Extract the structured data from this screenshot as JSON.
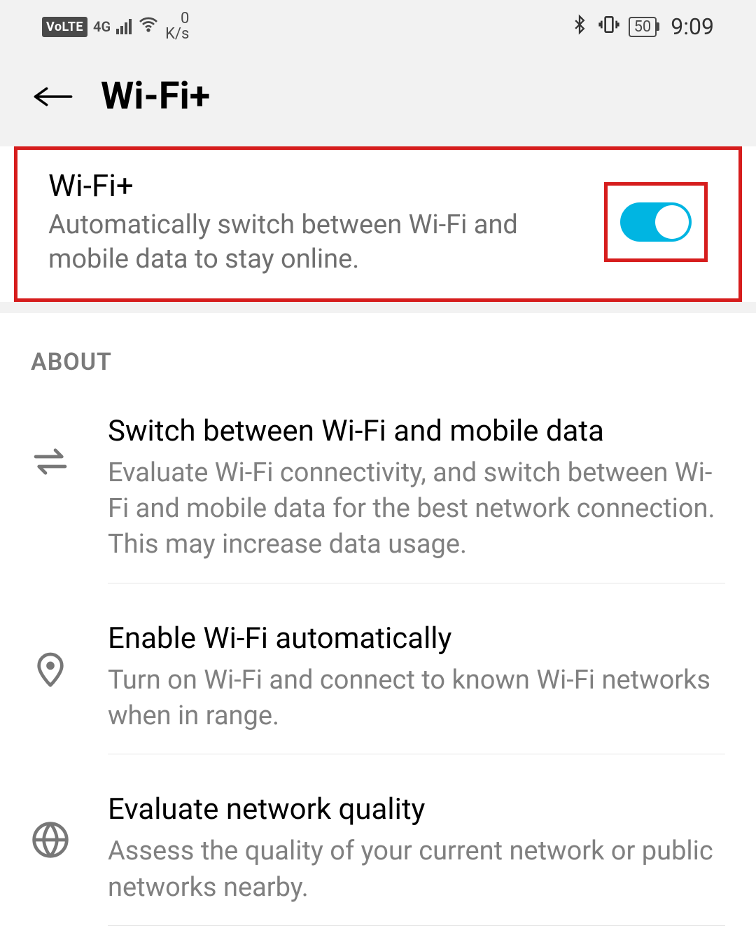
{
  "status_bar": {
    "volte": "VoLTE",
    "network": "4G",
    "data_rate_value": "0",
    "data_rate_unit": "K/s",
    "battery": "50",
    "time": "9:09"
  },
  "header": {
    "title": "Wi-Fi+"
  },
  "toggle": {
    "title": "Wi-Fi+",
    "description": "Automatically switch between Wi-Fi and mobile data to stay online.",
    "enabled": true
  },
  "about": {
    "header": "ABOUT",
    "items": [
      {
        "title": "Switch between Wi-Fi and mobile data",
        "description": "Evaluate Wi-Fi connectivity, and switch between Wi-Fi and mobile data for the best network connection. This may increase data usage."
      },
      {
        "title": "Enable Wi-Fi automatically",
        "description": "Turn on Wi-Fi and connect to known Wi-Fi networks when in range."
      },
      {
        "title": "Evaluate network quality",
        "description": "Assess the quality of your current network or public networks nearby."
      }
    ]
  },
  "colors": {
    "toggle_on": "#00b5e2",
    "highlight_border": "#d61d1d"
  }
}
